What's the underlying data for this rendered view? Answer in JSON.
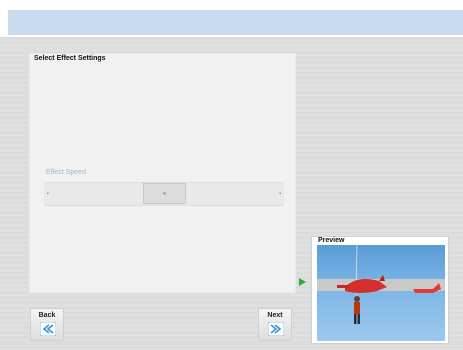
{
  "settings": {
    "title": "Select Effect Settings",
    "speed_label": "Effect Speed",
    "slider_min_glyph": "•",
    "slider_max_glyph": "•",
    "speed_value": 0.5
  },
  "preview": {
    "label": "Preview"
  },
  "nav": {
    "back_label": "Back",
    "next_label": "Next"
  },
  "icons": {
    "arrow": "play-arrow-icon",
    "back": "double-chevron-left-icon",
    "next": "double-chevron-right-icon"
  },
  "colors": {
    "header_bar": "#c9dcef",
    "speed_label": "#9fb3cf",
    "arrow": "#34a834",
    "nav_icon": "#3a8fd8"
  }
}
